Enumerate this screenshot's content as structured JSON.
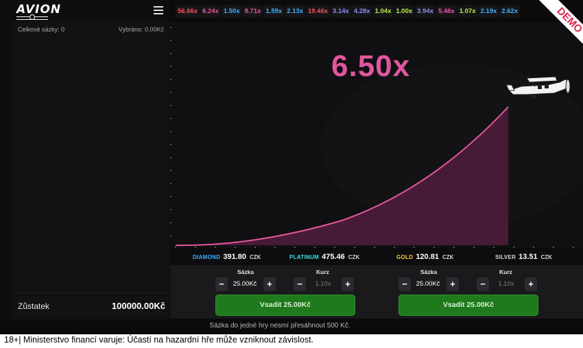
{
  "app": {
    "logo_text": "AVION",
    "demo_label": "DEMO"
  },
  "sidebar": {
    "total_bets": "Celkové sázky: 0",
    "selected": "Vybráno: 0.00Kč",
    "balance_label": "Zůstatek",
    "balance_value": "100000.00Kč"
  },
  "history": [
    {
      "value": "56.66x",
      "color": "#ff4d5a"
    },
    {
      "value": "6.24x",
      "color": "#e6569f"
    },
    {
      "value": "1.50x",
      "color": "#3fb0ff"
    },
    {
      "value": "8.71x",
      "color": "#e6569f"
    },
    {
      "value": "1.59x",
      "color": "#3fb0ff"
    },
    {
      "value": "2.13x",
      "color": "#3fb0ff"
    },
    {
      "value": "19.46x",
      "color": "#ff4d5a"
    },
    {
      "value": "3.14x",
      "color": "#8b8ff0"
    },
    {
      "value": "4.28x",
      "color": "#8b8ff0"
    },
    {
      "value": "1.04x",
      "color": "#b8f04a"
    },
    {
      "value": "1.00x",
      "color": "#b8f04a"
    },
    {
      "value": "3.94x",
      "color": "#8b8ff0"
    },
    {
      "value": "5.48x",
      "color": "#e6569f"
    },
    {
      "value": "1.07x",
      "color": "#b8f04a"
    },
    {
      "value": "2.19x",
      "color": "#3fb0ff"
    },
    {
      "value": "2.62x",
      "color": "#3fb0ff"
    }
  ],
  "game": {
    "multiplier": "6.50x",
    "curve_color": "#e6569f"
  },
  "jackpots": [
    {
      "name": "DIAMOND",
      "value": "391.80",
      "currency": "CZK",
      "color": "#3fb0ff"
    },
    {
      "name": "PLATINUM",
      "value": "475.46",
      "currency": "CZK",
      "color": "#42e0e6"
    },
    {
      "name": "GOLD",
      "value": "120.81",
      "currency": "CZK",
      "color": "#ffcf3a"
    },
    {
      "name": "SILVER",
      "value": "13.51",
      "currency": "CZK",
      "color": "#d6d6d6"
    }
  ],
  "bet_panels": [
    {
      "stake_label": "Sázka",
      "stake_value": "25.00Kč",
      "rate_label": "Kurz",
      "rate_placeholder": "1.10x",
      "button_label": "Vsadit 25.00Kč",
      "minus": "−",
      "plus": "+"
    },
    {
      "stake_label": "Sázka",
      "stake_value": "25.00Kč",
      "rate_label": "Kurz",
      "rate_placeholder": "1.10x",
      "button_label": "Vsadit 25.00Kč",
      "minus": "−",
      "plus": "+"
    }
  ],
  "limit_note": "Sázka do jedné hry nesmí přesáhnout 500 Kč.",
  "warning": "18+| Ministerstvo financí varuje: Účastí na hazardní hře může vzniknout závislost."
}
